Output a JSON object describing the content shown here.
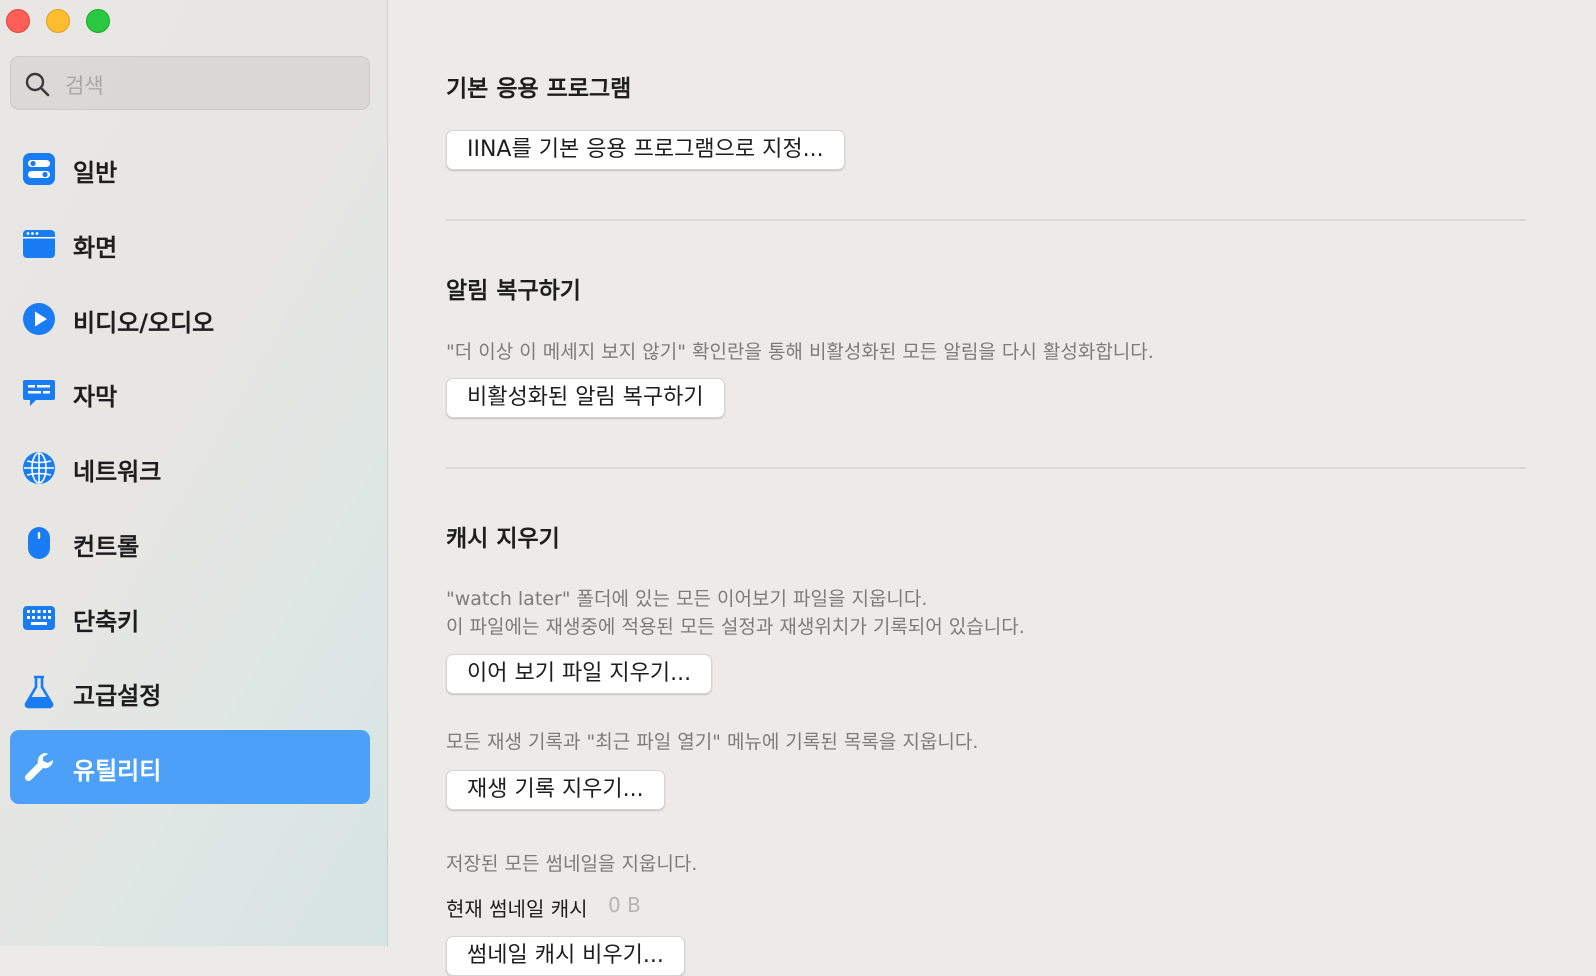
{
  "search": {
    "placeholder": "검색"
  },
  "sidebar": {
    "items": [
      {
        "label": "일반"
      },
      {
        "label": "화면"
      },
      {
        "label": "비디오/오디오"
      },
      {
        "label": "자막"
      },
      {
        "label": "네트워크"
      },
      {
        "label": "컨트롤"
      },
      {
        "label": "단축키"
      },
      {
        "label": "고급설정"
      },
      {
        "label": "유틸리티",
        "selected": true
      }
    ]
  },
  "main": {
    "default_app": {
      "title": "기본 응용 프로그램",
      "button": "IINA를 기본 응용 프로그램으로 지정..."
    },
    "restore_alerts": {
      "title": "알림 복구하기",
      "description": "\"더 이상 이 메세지 보지 않기\" 확인란을 통해 비활성화된 모든 알림을 다시 활성화합니다.",
      "button": "비활성화된 알림 복구하기"
    },
    "clear_cache": {
      "title": "캐시 지우기",
      "watch_later_desc_1": "\"watch later\" 폴더에 있는 모든 이어보기 파일을 지웁니다.",
      "watch_later_desc_2": "이 파일에는 재생중에 적용된 모든 설정과 재생위치가 기록되어 있습니다.",
      "watch_later_button": "이어 보기 파일 지우기...",
      "history_desc": "모든 재생 기록과 \"최근 파일 열기\" 메뉴에 기록된 목록을 지웁니다.",
      "history_button": "재생 기록 지우기...",
      "thumbnail_desc": "저장된 모든 썸네일을 지웁니다.",
      "thumbnail_cache_label": "현재 썸네일 캐시",
      "thumbnail_cache_value": "0 B",
      "thumbnail_button": "썸네일 캐시 비우기..."
    }
  },
  "colors": {
    "accent": "#4ca0f7",
    "icon_blue": "#1a7cf2",
    "close": "#fe5f57",
    "minimize": "#febc2e",
    "maximize": "#28c840"
  }
}
